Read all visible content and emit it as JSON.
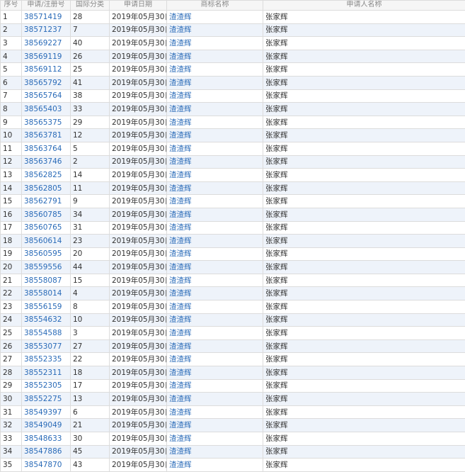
{
  "headers": [
    "序号",
    "申请/注册号",
    "国际分类",
    "申请日期",
    "商标名称",
    "申请人名称"
  ],
  "rows": [
    {
      "seq": "1",
      "reg": "38571419",
      "cls": "28",
      "date": "2019年05月30日",
      "mark": "渣渣辉",
      "applicant": "张家辉"
    },
    {
      "seq": "2",
      "reg": "38571237",
      "cls": "7",
      "date": "2019年05月30日",
      "mark": "渣渣辉",
      "applicant": "张家辉"
    },
    {
      "seq": "3",
      "reg": "38569227",
      "cls": "40",
      "date": "2019年05月30日",
      "mark": "渣渣辉",
      "applicant": "张家辉"
    },
    {
      "seq": "4",
      "reg": "38569119",
      "cls": "26",
      "date": "2019年05月30日",
      "mark": "渣渣辉",
      "applicant": "张家辉"
    },
    {
      "seq": "5",
      "reg": "38569112",
      "cls": "25",
      "date": "2019年05月30日",
      "mark": "渣渣辉",
      "applicant": "张家辉"
    },
    {
      "seq": "6",
      "reg": "38565792",
      "cls": "41",
      "date": "2019年05月30日",
      "mark": "渣渣辉",
      "applicant": "张家辉"
    },
    {
      "seq": "7",
      "reg": "38565764",
      "cls": "38",
      "date": "2019年05月30日",
      "mark": "渣渣辉",
      "applicant": "张家辉"
    },
    {
      "seq": "8",
      "reg": "38565403",
      "cls": "33",
      "date": "2019年05月30日",
      "mark": "渣渣辉",
      "applicant": "张家辉"
    },
    {
      "seq": "9",
      "reg": "38565375",
      "cls": "29",
      "date": "2019年05月30日",
      "mark": "渣渣辉",
      "applicant": "张家辉"
    },
    {
      "seq": "10",
      "reg": "38563781",
      "cls": "12",
      "date": "2019年05月30日",
      "mark": "渣渣辉",
      "applicant": "张家辉"
    },
    {
      "seq": "11",
      "reg": "38563764",
      "cls": "5",
      "date": "2019年05月30日",
      "mark": "渣渣辉",
      "applicant": "张家辉"
    },
    {
      "seq": "12",
      "reg": "38563746",
      "cls": "2",
      "date": "2019年05月30日",
      "mark": "渣渣辉",
      "applicant": "张家辉"
    },
    {
      "seq": "13",
      "reg": "38562825",
      "cls": "14",
      "date": "2019年05月30日",
      "mark": "渣渣辉",
      "applicant": "张家辉"
    },
    {
      "seq": "14",
      "reg": "38562805",
      "cls": "11",
      "date": "2019年05月30日",
      "mark": "渣渣辉",
      "applicant": "张家辉"
    },
    {
      "seq": "15",
      "reg": "38562791",
      "cls": "9",
      "date": "2019年05月30日",
      "mark": "渣渣辉",
      "applicant": "张家辉"
    },
    {
      "seq": "16",
      "reg": "38560785",
      "cls": "34",
      "date": "2019年05月30日",
      "mark": "渣渣辉",
      "applicant": "张家辉"
    },
    {
      "seq": "17",
      "reg": "38560765",
      "cls": "31",
      "date": "2019年05月30日",
      "mark": "渣渣辉",
      "applicant": "张家辉"
    },
    {
      "seq": "18",
      "reg": "38560614",
      "cls": "23",
      "date": "2019年05月30日",
      "mark": "渣渣辉",
      "applicant": "张家辉"
    },
    {
      "seq": "19",
      "reg": "38560595",
      "cls": "20",
      "date": "2019年05月30日",
      "mark": "渣渣辉",
      "applicant": "张家辉"
    },
    {
      "seq": "20",
      "reg": "38559556",
      "cls": "44",
      "date": "2019年05月30日",
      "mark": "渣渣辉",
      "applicant": "张家辉"
    },
    {
      "seq": "21",
      "reg": "38558087",
      "cls": "15",
      "date": "2019年05月30日",
      "mark": "渣渣辉",
      "applicant": "张家辉"
    },
    {
      "seq": "22",
      "reg": "38558014",
      "cls": "4",
      "date": "2019年05月30日",
      "mark": "渣渣辉",
      "applicant": "张家辉"
    },
    {
      "seq": "23",
      "reg": "38556159",
      "cls": "8",
      "date": "2019年05月30日",
      "mark": "渣渣辉",
      "applicant": "张家辉"
    },
    {
      "seq": "24",
      "reg": "38554632",
      "cls": "10",
      "date": "2019年05月30日",
      "mark": "渣渣辉",
      "applicant": "张家辉"
    },
    {
      "seq": "25",
      "reg": "38554588",
      "cls": "3",
      "date": "2019年05月30日",
      "mark": "渣渣辉",
      "applicant": "张家辉"
    },
    {
      "seq": "26",
      "reg": "38553077",
      "cls": "27",
      "date": "2019年05月30日",
      "mark": "渣渣辉",
      "applicant": "张家辉"
    },
    {
      "seq": "27",
      "reg": "38552335",
      "cls": "22",
      "date": "2019年05月30日",
      "mark": "渣渣辉",
      "applicant": "张家辉"
    },
    {
      "seq": "28",
      "reg": "38552311",
      "cls": "18",
      "date": "2019年05月30日",
      "mark": "渣渣辉",
      "applicant": "张家辉"
    },
    {
      "seq": "29",
      "reg": "38552305",
      "cls": "17",
      "date": "2019年05月30日",
      "mark": "渣渣辉",
      "applicant": "张家辉"
    },
    {
      "seq": "30",
      "reg": "38552275",
      "cls": "13",
      "date": "2019年05月30日",
      "mark": "渣渣辉",
      "applicant": "张家辉"
    },
    {
      "seq": "31",
      "reg": "38549397",
      "cls": "6",
      "date": "2019年05月30日",
      "mark": "渣渣辉",
      "applicant": "张家辉"
    },
    {
      "seq": "32",
      "reg": "38549049",
      "cls": "21",
      "date": "2019年05月30日",
      "mark": "渣渣辉",
      "applicant": "张家辉"
    },
    {
      "seq": "33",
      "reg": "38548633",
      "cls": "30",
      "date": "2019年05月30日",
      "mark": "渣渣辉",
      "applicant": "张家辉"
    },
    {
      "seq": "34",
      "reg": "38547886",
      "cls": "45",
      "date": "2019年05月30日",
      "mark": "渣渣辉",
      "applicant": "张家辉"
    },
    {
      "seq": "35",
      "reg": "38547870",
      "cls": "43",
      "date": "2019年05月30日",
      "mark": "渣渣辉",
      "applicant": "张家辉"
    }
  ],
  "colors": {
    "link": "#2a6bb8",
    "row_alt": "#eef3fa",
    "header_bg": "#f6f6f6",
    "header_text": "#888888",
    "border": "#dcdcdc"
  }
}
